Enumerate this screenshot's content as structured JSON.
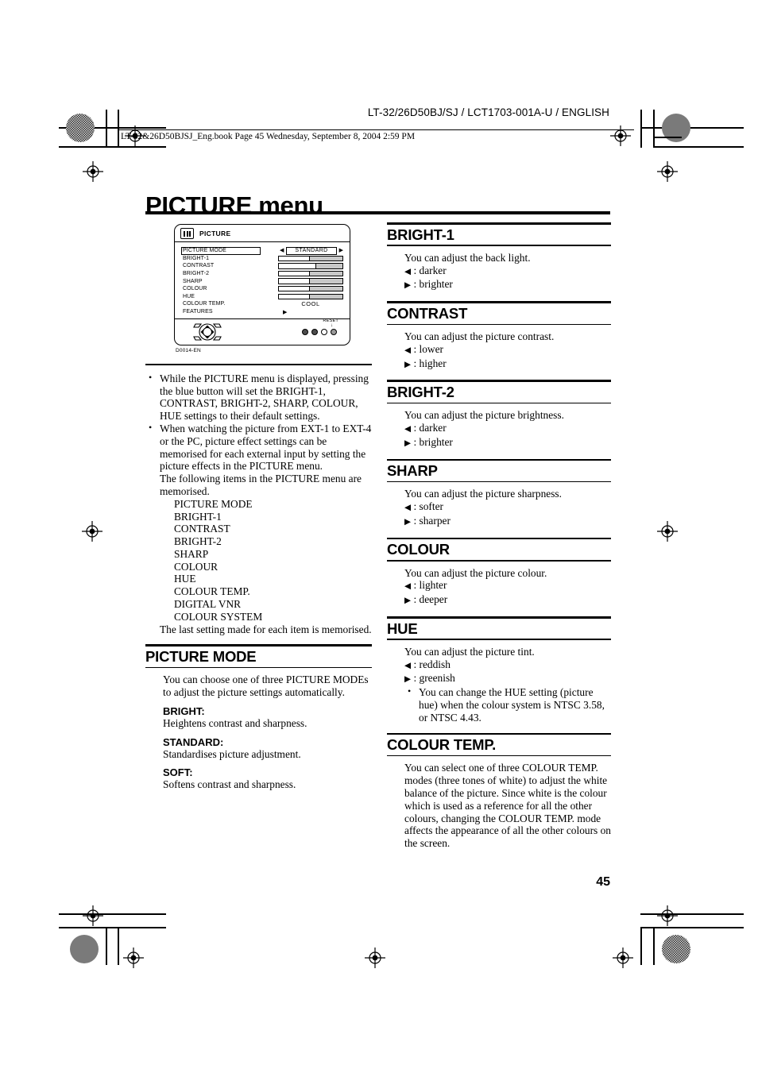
{
  "header": {
    "doc_code": "LT-32/26D50BJ/SJ / LCT1703-001A-U / ENGLISH",
    "book_line": "LT-32&26D50BJSJ_Eng.book  Page 45  Wednesday, September 8, 2004  2:59 PM"
  },
  "page_title": "PICTURE menu",
  "page_number": "45",
  "osd": {
    "title": "PICTURE",
    "figure_code": "D0014-EN",
    "reset_label": "RESET",
    "rows": [
      {
        "label": "PICTURE MODE",
        "type": "mode",
        "value": "STANDARD",
        "selected": true
      },
      {
        "label": "BRIGHT-1",
        "type": "bar",
        "fill": 48
      },
      {
        "label": "CONTRAST",
        "type": "bar",
        "fill": 58
      },
      {
        "label": "BRIGHT-2",
        "type": "bar",
        "fill": 48
      },
      {
        "label": "SHARP",
        "type": "bar",
        "fill": 48
      },
      {
        "label": "COLOUR",
        "type": "bar",
        "fill": 48
      },
      {
        "label": "HUE",
        "type": "bar",
        "fill": 48
      },
      {
        "label": "COLOUR TEMP.",
        "type": "text",
        "value": "COOL"
      },
      {
        "label": "FEATURES",
        "type": "arrow",
        "value": "▶"
      }
    ]
  },
  "notes": {
    "bullet1": "While the PICTURE menu is displayed, pressing the blue button will set the BRIGHT-1, CONTRAST, BRIGHT-2, SHARP, COLOUR, HUE settings to their default settings.",
    "bullet2": "When watching the picture from EXT-1 to EXT-4 or the PC, picture effect settings can be memorised for each external input by setting the picture effects in the PICTURE menu.",
    "bullet2_line2": "The following items in the PICTURE menu are memorised.",
    "memorised_items": [
      "PICTURE MODE",
      "BRIGHT-1",
      "CONTRAST",
      "BRIGHT-2",
      "SHARP",
      "COLOUR",
      "HUE",
      "COLOUR TEMP.",
      "DIGITAL VNR",
      "COLOUR SYSTEM"
    ],
    "closing": "The last setting made for each item is memorised."
  },
  "picture_mode": {
    "heading": "PICTURE MODE",
    "intro": "You can choose one of three PICTURE MODEs to adjust the picture settings automatically.",
    "modes": [
      {
        "name": "BRIGHT:",
        "desc": "Heightens contrast and sharpness."
      },
      {
        "name": "STANDARD:",
        "desc": "Standardises picture adjustment."
      },
      {
        "name": "SOFT:",
        "desc": "Softens contrast and sharpness."
      }
    ]
  },
  "sections": [
    {
      "heading": "BRIGHT-1",
      "intro": "You can adjust the back light.",
      "left_arrow": "◀",
      "right_arrow": "▶",
      "left_text": ": darker",
      "right_text": ": brighter"
    },
    {
      "heading": "CONTRAST",
      "intro": "You can adjust the picture contrast.",
      "left_arrow": "◀",
      "right_arrow": "▶",
      "left_text": ": lower",
      "right_text": ": higher"
    },
    {
      "heading": "BRIGHT-2",
      "intro": "You can adjust the picture brightness.",
      "left_arrow": "◀",
      "right_arrow": "▶",
      "left_text": ": darker",
      "right_text": ": brighter"
    },
    {
      "heading": "SHARP",
      "intro": "You can adjust the picture sharpness.",
      "left_arrow": "◀",
      "right_arrow": "▶",
      "left_text": ": softer",
      "right_text": ": sharper"
    },
    {
      "heading": "COLOUR",
      "intro": "You can adjust the picture colour.",
      "left_arrow": "◀",
      "right_arrow": "▶",
      "left_text": ": lighter",
      "right_text": ": deeper"
    },
    {
      "heading": "HUE",
      "intro": "You can adjust the picture tint.",
      "left_arrow": "◀",
      "right_arrow": "▶",
      "left_text": ": reddish",
      "right_text": ": greenish",
      "note": "You can change the HUE setting (picture hue) when the colour system is NTSC 3.58, or NTSC 4.43."
    }
  ],
  "colour_temp": {
    "heading": "COLOUR TEMP.",
    "body": "You can select one of three COLOUR TEMP. modes (three tones of white) to adjust the white balance of the picture. Since white is the colour which is used as a reference for all the other colours, changing the COLOUR TEMP. mode affects the appearance of all the other colours on the screen."
  }
}
